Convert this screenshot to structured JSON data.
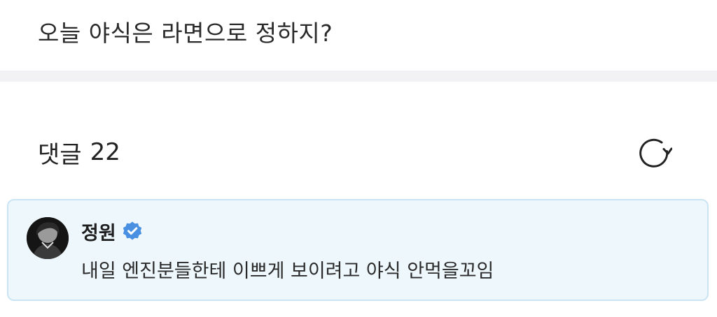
{
  "post": {
    "text": "오늘 야식은 라면으로 정하지?"
  },
  "comments": {
    "label": "댓글",
    "count": "22",
    "refresh_icon": "refresh-icon"
  },
  "comment": {
    "author": "정원",
    "verified_icon": "verified-badge-icon",
    "text": "내일 엔진분들한테 이쁘게 보이려고 야식 안먹을꼬임",
    "card_bg": "#edf7fc",
    "card_border": "#cbe4f3",
    "verified_color": "#4a90e2"
  }
}
